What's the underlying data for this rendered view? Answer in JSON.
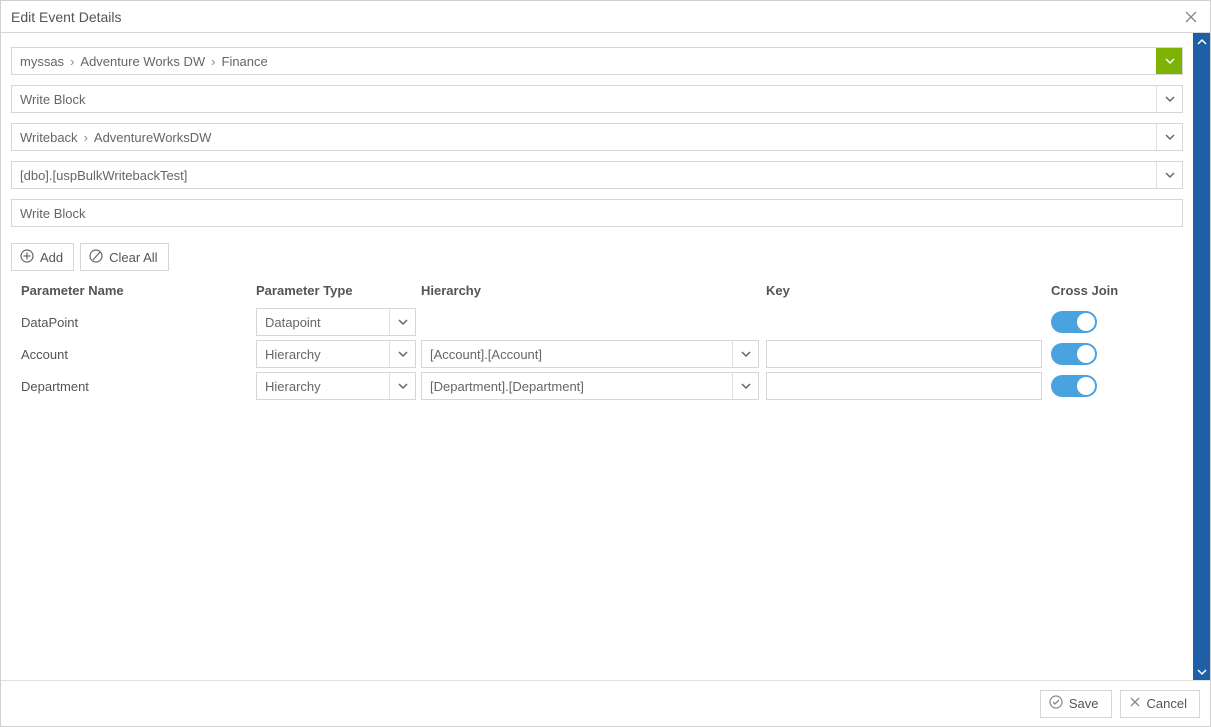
{
  "window": {
    "title": "Edit Event Details"
  },
  "fields": {
    "breadcrumb": [
      "myssas",
      "Adventure Works DW",
      "Finance"
    ],
    "event_type": "Write Block",
    "connection": [
      "Writeback",
      "AdventureWorksDW"
    ],
    "procedure": "[dbo].[uspBulkWritebackTest]",
    "name": "Write Block"
  },
  "toolbar": {
    "add": "Add",
    "clear": "Clear All"
  },
  "columns": {
    "pname": "Parameter Name",
    "ptype": "Parameter Type",
    "hierarchy": "Hierarchy",
    "key": "Key",
    "crossjoin": "Cross Join"
  },
  "rows": [
    {
      "pname": "DataPoint",
      "ptype": "Datapoint",
      "hierarchy": "",
      "key": "",
      "crossjoin": true
    },
    {
      "pname": "Account",
      "ptype": "Hierarchy",
      "hierarchy": "[Account].[Account]",
      "key": "",
      "crossjoin": true
    },
    {
      "pname": "Department",
      "ptype": "Hierarchy",
      "hierarchy": "[Department].[Department]",
      "key": "",
      "crossjoin": true
    }
  ],
  "footer": {
    "save": "Save",
    "cancel": "Cancel"
  }
}
